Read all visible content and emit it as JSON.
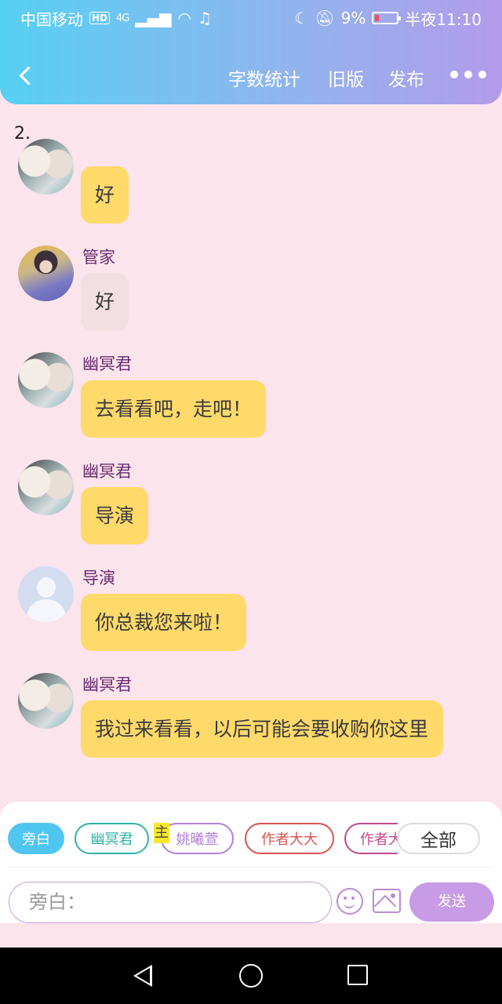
{
  "status_bar": {
    "carrier": "中国移动",
    "hd": "HD",
    "network": "4G",
    "battery": "9%",
    "time": "半夜11:10"
  },
  "header": {
    "word_count": "字数统计",
    "old_version": "旧版",
    "publish": "发布"
  },
  "page_number": "2.",
  "messages": [
    {
      "name": "",
      "text": "好",
      "avatar": "twins-avatar"
    },
    {
      "name": "管家",
      "text": "好",
      "avatar": "butler-avatar"
    },
    {
      "name": "幽冥君",
      "text": "去看看吧，走吧！",
      "avatar": "twins-avatar"
    },
    {
      "name": "幽冥君",
      "text": "导演",
      "avatar": "twins-avatar"
    },
    {
      "name": "导演",
      "text": "你总裁您来啦！",
      "avatar": "default-avatar"
    },
    {
      "name": "幽冥君",
      "text": "我过来看看，以后可能会要收购你这里",
      "avatar": "twins-avatar"
    }
  ],
  "role_chips": [
    {
      "label": "旁白",
      "color": "#4fc6f0"
    },
    {
      "label": "幽冥君",
      "color": "#2fb3a8"
    },
    {
      "label": "姚曦萱",
      "color": "#b07fd6"
    },
    {
      "label": "作者大大",
      "color": "#d9534f"
    },
    {
      "label": "作者大",
      "color": "#c04a8c"
    },
    {
      "label": "全部",
      "color": "#bbbbbb"
    }
  ],
  "main_tag": "主",
  "input": {
    "placeholder": "旁白："
  },
  "send_label": "发送",
  "icons": [
    "back-icon",
    "more-icon",
    "emoji-icon",
    "image-icon",
    "nav-back-icon",
    "nav-home-icon",
    "nav-recent-icon"
  ]
}
